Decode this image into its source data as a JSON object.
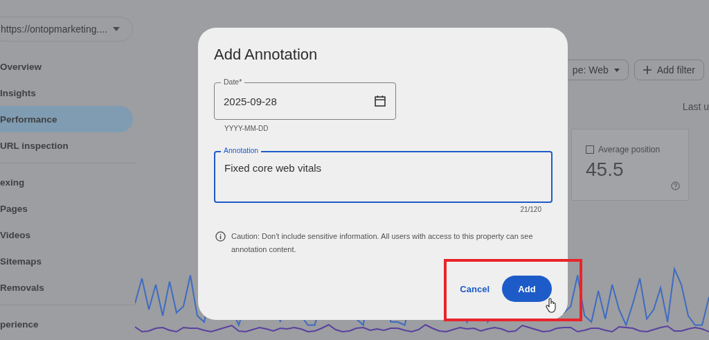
{
  "sidebar": {
    "property_selector": "https://ontopmarketing....",
    "groups": [
      {
        "items": [
          {
            "label": "Overview",
            "selected": false
          },
          {
            "label": "Insights",
            "selected": false
          },
          {
            "label": "Performance",
            "selected": true
          },
          {
            "label": "URL inspection",
            "selected": false
          }
        ]
      },
      {
        "items": [
          {
            "label": "exing",
            "selected": false
          },
          {
            "label": "Pages",
            "selected": false
          },
          {
            "label": "Videos",
            "selected": false
          },
          {
            "label": "Sitemaps",
            "selected": false
          },
          {
            "label": "Removals",
            "selected": false
          }
        ]
      },
      {
        "items": [
          {
            "label": "perience",
            "selected": false
          }
        ]
      }
    ]
  },
  "main": {
    "filters": [
      {
        "label": "pe: Web",
        "kind": "dropdown"
      },
      {
        "label": "Add filter",
        "kind": "add"
      }
    ],
    "last_updated": "Last u",
    "metric_card": {
      "label": "Average position",
      "value": "45.5",
      "checked": false
    }
  },
  "dialog": {
    "title": "Add Annotation",
    "date_field": {
      "label": "Date*",
      "value": "2025-09-28",
      "helper": "YYYY-MM-DD"
    },
    "annotation_field": {
      "label": "Annotation",
      "value": "Fixed core web vitals",
      "counter": "21/120"
    },
    "caution": "Caution: Don't include sensitive information. All users with access to this property can see annotation content.",
    "buttons": [
      {
        "label": "Cancel",
        "kind": "text"
      },
      {
        "label": "Add",
        "kind": "filled"
      }
    ]
  }
}
